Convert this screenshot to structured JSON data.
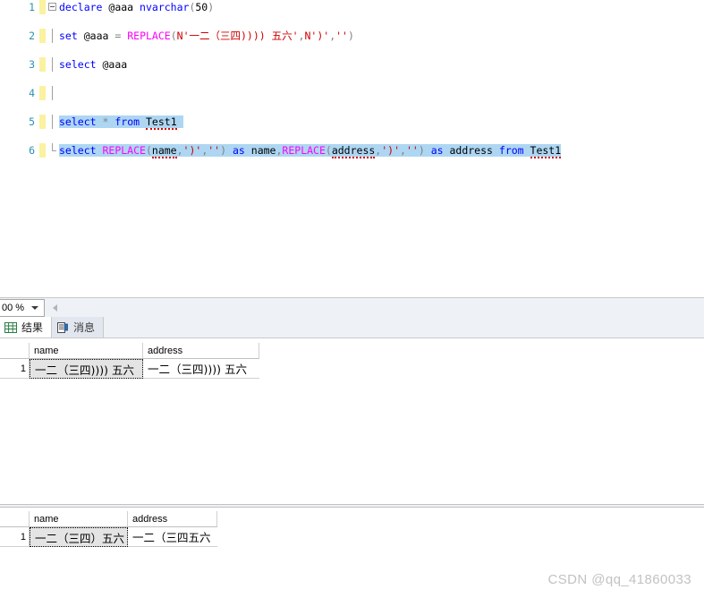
{
  "editor": {
    "lines": [
      {
        "num": "1",
        "text": "declare @aaa nvarchar(50)"
      },
      {
        "num": "2",
        "text": "set @aaa = REPLACE(N'一二（三四)))) 五六' ,N')','')"
      },
      {
        "num": "3",
        "text": "select @aaa"
      },
      {
        "num": "4",
        "text": ""
      },
      {
        "num": "5",
        "text": "select * from Test1"
      },
      {
        "num": "6",
        "text": "select REPLACE(name,')','') as name,REPLACE(address,')','') as address from Test1"
      }
    ],
    "tokens": {
      "kw_declare": "declare",
      "var_aaa": "@aaa",
      "type_nvarchar": "nvarchar",
      "paren_open": "(",
      "num_50": "50",
      "paren_close": ")",
      "kw_set": "set",
      "eq": "=",
      "fn_replace": "REPLACE",
      "str_n_prefix": "N'",
      "str_body": "一二（三四)))) 五六'",
      "comma": ",",
      "str_paren": "N')'",
      "str_empty": "''",
      "kw_select": "select",
      "star": "*",
      "kw_from": "from",
      "tbl_test1": "Test1",
      "col_name": "name",
      "col_address": "address",
      "kw_as": "as",
      "lit_paren": "')'",
      "lit_empty": "''"
    }
  },
  "zoombar": {
    "zoom_value": "00 %",
    "caret_icon": "chevron-down-icon",
    "scroll_left_icon": "scroll-left-arrow-icon"
  },
  "result_tabs": [
    {
      "label": "结果",
      "icon": "grid-icon",
      "active": true
    },
    {
      "label": "消息",
      "icon": "message-icon",
      "active": false
    }
  ],
  "grid_top": {
    "columns": [
      "name",
      "address"
    ],
    "row_header": "1",
    "rows": [
      [
        "一二（三四)))) 五六",
        "一二（三四)))) 五六"
      ]
    ]
  },
  "grid_bottom": {
    "columns": [
      "name",
      "address"
    ],
    "row_header": "1",
    "rows": [
      [
        "一二（三四）五六",
        "一二（三四五六"
      ]
    ]
  },
  "watermark": {
    "text": "CSDN @qq_41860033"
  },
  "colors": {
    "keyword": "#0000ff",
    "function": "#ff00ff",
    "string": "#ce0000",
    "linenumber": "#2b91af",
    "selection": "#add6f2",
    "changebar": "#fbf2a0",
    "squiggle": "#d40000",
    "chrome": "#eef1f6",
    "watermark": "#c2c2c2"
  }
}
